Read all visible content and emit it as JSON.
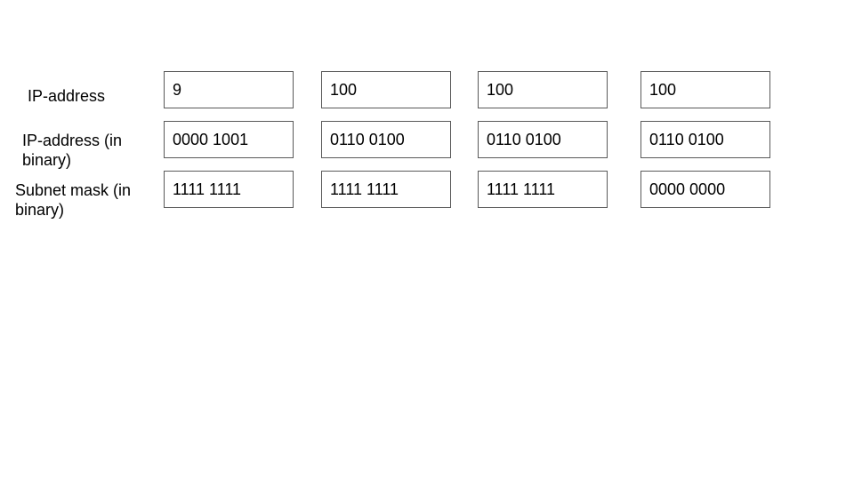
{
  "rows": [
    {
      "label": "IP-address",
      "cells": [
        "9",
        "100",
        "100",
        "100"
      ]
    },
    {
      "label": "IP-address (in\nbinary)",
      "cells": [
        "0000 1001",
        "0110 0100",
        "0110 0100",
        "0110 0100"
      ]
    },
    {
      "label": "Subnet mask (in\nbinary)",
      "cells": [
        "1111 1111",
        "1111 1111",
        "1111 1111",
        "0000 0000"
      ]
    }
  ]
}
